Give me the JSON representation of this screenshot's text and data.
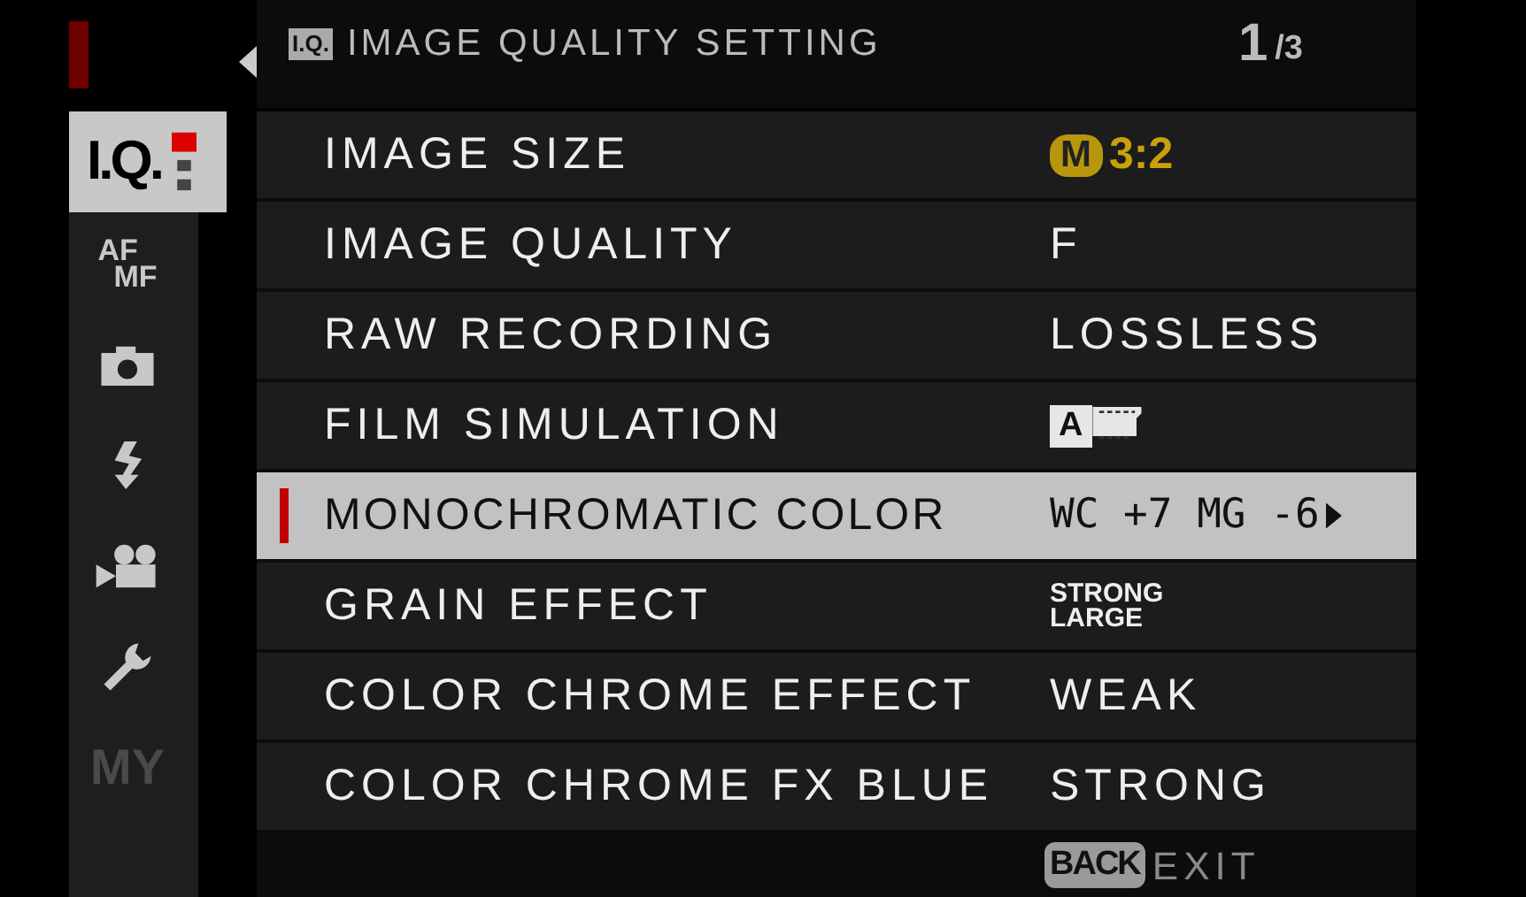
{
  "sidebar": {
    "tabs": [
      {
        "kind": "iq",
        "label": "I.Q.",
        "selected": true,
        "disabled": false
      },
      {
        "kind": "stack",
        "lines": [
          "AF",
          "MF"
        ],
        "selected": false,
        "disabled": false
      },
      {
        "kind": "camera",
        "selected": false,
        "disabled": false
      },
      {
        "kind": "flash",
        "selected": false,
        "disabled": false
      },
      {
        "kind": "movie",
        "selected": false,
        "disabled": false
      },
      {
        "kind": "wrench",
        "selected": false,
        "disabled": false
      },
      {
        "kind": "text",
        "label": "MY",
        "selected": false,
        "disabled": true
      }
    ]
  },
  "header": {
    "badge": "I.Q.",
    "title": "IMAGE QUALITY SETTING",
    "page": "1",
    "page_total": "/3"
  },
  "rows": [
    {
      "label": "IMAGE SIZE",
      "selected": false,
      "value": {
        "kind": "size",
        "badge": "M",
        "text": "3:2"
      }
    },
    {
      "label": "IMAGE QUALITY",
      "selected": false,
      "value": {
        "kind": "text",
        "text": "F"
      }
    },
    {
      "label": "RAW RECORDING",
      "selected": false,
      "value": {
        "kind": "text",
        "text": "LOSSLESS"
      }
    },
    {
      "label": "FILM SIMULATION",
      "selected": false,
      "value": {
        "kind": "film",
        "badge": "A"
      }
    },
    {
      "label": "MONOCHROMATIC COLOR",
      "selected": true,
      "value": {
        "kind": "submenu",
        "text": "WC +7 MG -6"
      }
    },
    {
      "label": "GRAIN EFFECT",
      "selected": false,
      "value": {
        "kind": "stacked",
        "lines": [
          "STRONG",
          "LARGE"
        ]
      }
    },
    {
      "label": "COLOR CHROME EFFECT",
      "selected": false,
      "value": {
        "kind": "text",
        "text": "WEAK"
      }
    },
    {
      "label": "COLOR CHROME FX BLUE",
      "selected": false,
      "value": {
        "kind": "text",
        "text": "STRONG"
      }
    }
  ],
  "footer": {
    "key": "BACK",
    "label": "EXIT"
  }
}
